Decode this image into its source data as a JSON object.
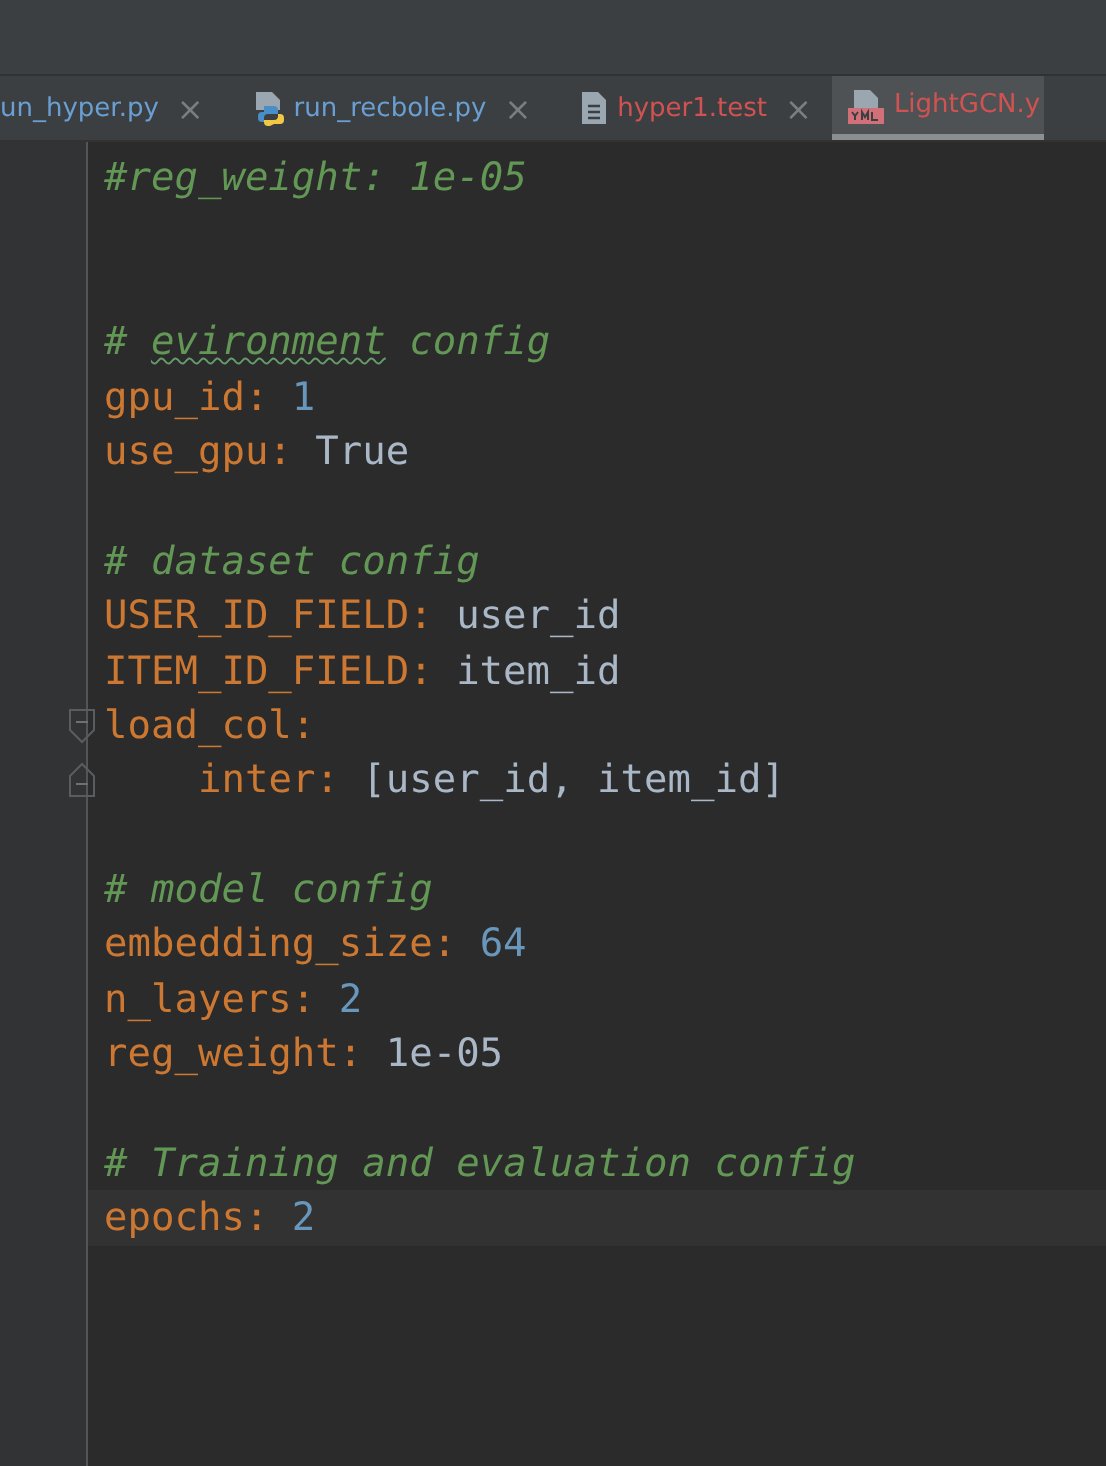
{
  "tabs": [
    {
      "label": "un_hyper.py",
      "kind": "plain",
      "color": "#6a9fd4",
      "selected": false,
      "close": "×"
    },
    {
      "label": "run_recbole.py",
      "kind": "python",
      "color": "#6a9fd4",
      "selected": false,
      "close": "×"
    },
    {
      "label": "hyper1.test",
      "kind": "text",
      "color": "#d25252",
      "selected": false,
      "close": "×"
    },
    {
      "label": "LightGCN.y",
      "kind": "yml",
      "color": "#d25252",
      "selected": true
    }
  ],
  "lines": [
    {
      "kind": "comment",
      "parts": [
        {
          "text": "#reg_weight: 1e-05",
          "typo": false
        }
      ]
    },
    {
      "kind": "blank"
    },
    {
      "kind": "blank"
    },
    {
      "kind": "comment",
      "parts": [
        {
          "text": "# ",
          "typo": false
        },
        {
          "text": "evironment",
          "typo": true
        },
        {
          "text": " config",
          "typo": false
        }
      ]
    },
    {
      "kind": "pair",
      "key": "gpu_id",
      "colon": ":",
      "value": {
        "kind": "number",
        "text": "1"
      }
    },
    {
      "kind": "pair",
      "key": "use_gpu",
      "colon": ":",
      "value": {
        "kind": "text",
        "text": "True"
      }
    },
    {
      "kind": "blank"
    },
    {
      "kind": "comment",
      "parts": [
        {
          "text": "# dataset config",
          "typo": false
        }
      ]
    },
    {
      "kind": "pair",
      "key": "USER_ID_FIELD",
      "colon": ":",
      "value": {
        "kind": "text",
        "text": "user_id"
      }
    },
    {
      "kind": "pair",
      "key": "ITEM_ID_FIELD",
      "colon": ":",
      "value": {
        "kind": "text",
        "text": "item_id"
      }
    },
    {
      "kind": "pair",
      "key": "load_col",
      "colon": ":",
      "children": [
        {
          "kind": "pair",
          "key": "inter",
          "colon": ":",
          "value": {
            "kind": "text",
            "text": "[user_id, item_id]"
          }
        }
      ]
    },
    {
      "kind": "blank"
    },
    {
      "kind": "comment",
      "parts": [
        {
          "text": "# model config",
          "typo": false
        }
      ]
    },
    {
      "kind": "pair",
      "key": "embedding_size",
      "colon": ":",
      "value": {
        "kind": "number",
        "text": "64"
      }
    },
    {
      "kind": "pair",
      "key": "n_layers",
      "colon": ":",
      "value": {
        "kind": "number",
        "text": "2"
      }
    },
    {
      "kind": "pair",
      "key": "reg_weight",
      "colon": ":",
      "value": {
        "kind": "text",
        "text": "1e-05"
      }
    },
    {
      "kind": "blank"
    },
    {
      "kind": "comment",
      "parts": [
        {
          "text": "# Training and evaluation config",
          "typo": false
        }
      ]
    },
    {
      "kind": "pair",
      "key": "epochs",
      "colon": ":",
      "value": {
        "kind": "number",
        "text": "2"
      },
      "current": true
    }
  ]
}
